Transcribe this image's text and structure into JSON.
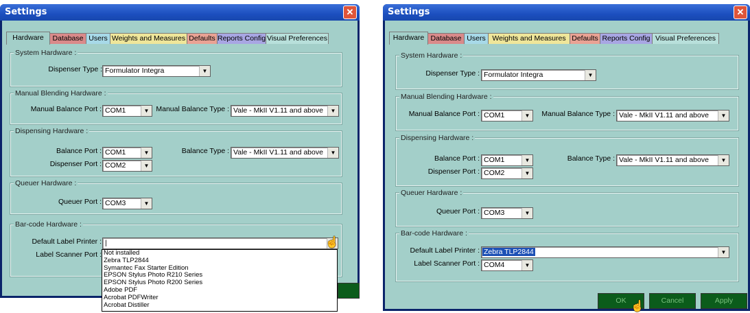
{
  "dialog_title": "Settings",
  "close_glyph": "✕",
  "tabs": [
    {
      "label": "Hardware",
      "color": "#a3cfc9"
    },
    {
      "label": "Database",
      "color": "#d98a8a"
    },
    {
      "label": "Users",
      "color": "#a7d9e8"
    },
    {
      "label": "Weights and Measures",
      "color": "#efe69a"
    },
    {
      "label": "Defaults",
      "color": "#e9a294"
    },
    {
      "label": "Reports Config",
      "color": "#a8a6e3"
    },
    {
      "label": "Visual Preferences",
      "color": "#b8e0db"
    }
  ],
  "sections": {
    "system": "System Hardware :",
    "manual": "Manual Blending Hardware :",
    "dispensing": "Dispensing Hardware :",
    "queuer": "Queuer Hardware :",
    "barcode": "Bar-code Hardware :"
  },
  "fields": {
    "dispenser_type_label": "Dispenser Type :",
    "dispenser_type_value": "Formulator Integra",
    "manual_balance_port_label": "Manual Balance Port :",
    "manual_balance_port_value": "COM1",
    "manual_balance_type_label": "Manual Balance Type :",
    "manual_balance_type_value": "Vale - MkII V1.11 and above",
    "balance_port_label": "Balance Port :",
    "balance_port_value": "COM1",
    "balance_type_label": "Balance Type :",
    "balance_type_value": "Vale - MkII V1.11 and above",
    "dispenser_port_label": "Dispenser Port :",
    "dispenser_port_value": "COM2",
    "queuer_port_label": "Queuer Port :",
    "queuer_port_value": "COM3",
    "default_label_printer_label": "Default Label Printer :",
    "label_scanner_port_label": "Label Scanner Port :"
  },
  "left": {
    "default_label_printer_value": "|",
    "printer_options": [
      "Not installed",
      "Zebra  TLP2844",
      "Symantec Fax Starter Edition",
      "EPSON Stylus Photo R210 Series",
      "EPSON Stylus Photo R200 Series",
      "Adobe PDF",
      "Acrobat PDFWriter",
      "Acrobat Distiller"
    ]
  },
  "right": {
    "default_label_printer_value": "Zebra  TLP2844",
    "label_scanner_port_value": "COM4",
    "buttons": {
      "ok": "OK",
      "cancel": "Cancel",
      "apply": "Apply"
    }
  },
  "icons": {
    "dropdown_arrow": "▼",
    "cursor": "☝"
  }
}
